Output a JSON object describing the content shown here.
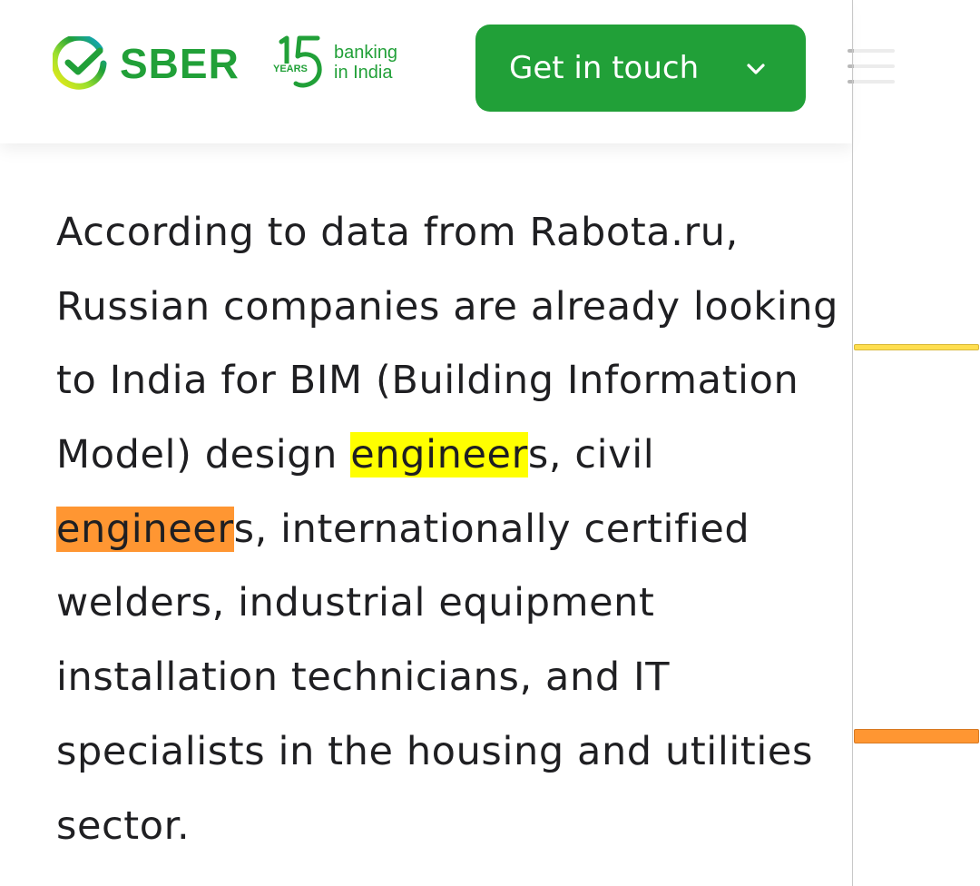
{
  "header": {
    "brand": "SBER",
    "anniversary": {
      "number": "15",
      "years": "YEARS",
      "line1": "banking",
      "line2": "in India"
    },
    "cta_label": "Get in touch",
    "cta_icon": "chevron-down-icon",
    "menu_icon": "hamburger-menu-icon",
    "brand_color": "#21a038"
  },
  "article": {
    "lines": [
      [
        "According to data from Rabota.ru,"
      ],
      [
        "Russian companies are already looking"
      ],
      [
        "to India for BIM (Building Information"
      ],
      [
        "Model) design ",
        "engineer",
        "s, civil"
      ],
      [
        "engineer",
        "s, internationally certified"
      ],
      [
        "welders, industrial equipment"
      ],
      [
        "installation technicians, and IT"
      ],
      [
        "specialists in the housing and utilities"
      ],
      [
        "sector."
      ]
    ]
  },
  "highlights": {
    "search_term": "engineer",
    "match_color": "#ffff00",
    "active_match_color": "#ff9632"
  }
}
